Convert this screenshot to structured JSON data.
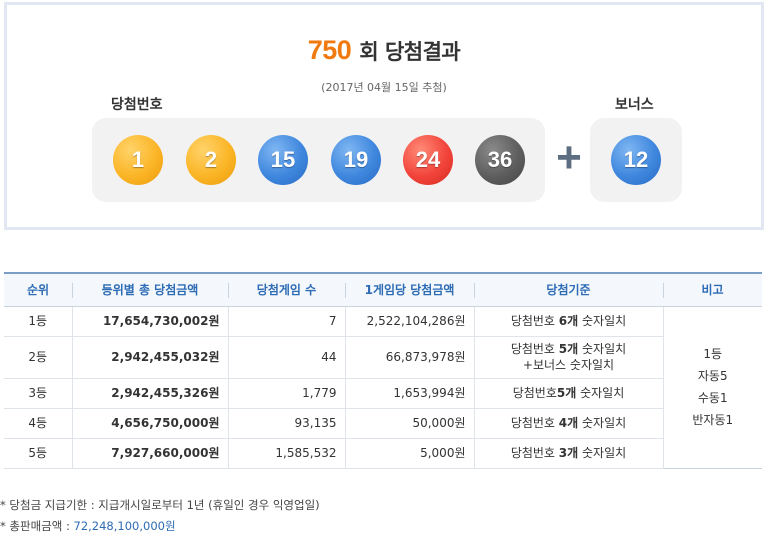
{
  "result": {
    "round_number": "750",
    "round_suffix": "회 당첨결과",
    "draw_date": "(2017년 04월 15일 추첨)",
    "winning_label": "당첨번호",
    "bonus_label": "보너스",
    "plus": "+",
    "balls": [
      {
        "number": "1",
        "color": "#fbb526"
      },
      {
        "number": "2",
        "color": "#fbb526"
      },
      {
        "number": "15",
        "color": "#3f87de"
      },
      {
        "number": "19",
        "color": "#3f87de"
      },
      {
        "number": "24",
        "color": "#f2443a"
      },
      {
        "number": "36",
        "color": "#5e5e5e"
      }
    ],
    "bonus_ball": {
      "number": "12",
      "color": "#3f87de"
    }
  },
  "table": {
    "headers": [
      "순위",
      "등위별 총 당첨금액",
      "당첨게임 수",
      "1게임당 당첨금액",
      "당첨기준",
      "비고"
    ],
    "rows": [
      {
        "rank": "1등",
        "total": "17,654,730,002원",
        "games": "7",
        "per_game": "2,522,104,286원",
        "crit_pre": "당첨번호 ",
        "crit_bold": "6개",
        "crit_post": " 숫자일치",
        "crit_line2": ""
      },
      {
        "rank": "2등",
        "total": "2,942,455,032원",
        "games": "44",
        "per_game": "66,873,978원",
        "crit_pre": "당첨번호 ",
        "crit_bold": "5개",
        "crit_post": " 숫자일치",
        "crit_line2": "+보너스 숫자일치"
      },
      {
        "rank": "3등",
        "total": "2,942,455,326원",
        "games": "1,779",
        "per_game": "1,653,994원",
        "crit_pre": "당첨번호",
        "crit_bold": "5개",
        "crit_post": " 숫자일치",
        "crit_line2": ""
      },
      {
        "rank": "4등",
        "total": "4,656,750,000원",
        "games": "93,135",
        "per_game": "50,000원",
        "crit_pre": "당첨번호 ",
        "crit_bold": "4개",
        "crit_post": " 숫자일치",
        "crit_line2": ""
      },
      {
        "rank": "5등",
        "total": "7,927,660,000원",
        "games": "1,585,532",
        "per_game": "5,000원",
        "crit_pre": "당첨번호 ",
        "crit_bold": "3개",
        "crit_post": " 숫자일치",
        "crit_line2": ""
      }
    ],
    "note_lines": [
      "1등",
      "자동5",
      "수동1",
      "반자동1"
    ]
  },
  "footnotes": {
    "deadline": "* 당첨금 지급기한 : 지급개시일로부터 1년 (휴일인 경우 익영업일)",
    "total_sales_label": "* 총판매금액 : ",
    "total_sales_value": "72,248,100,000원"
  }
}
